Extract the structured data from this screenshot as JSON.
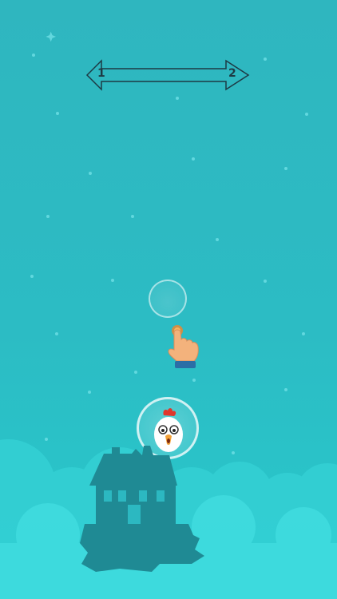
{
  "level": {
    "current": "1",
    "next": "2"
  },
  "hint": {
    "icon": "tap-hand-icon"
  },
  "player": {
    "icon": "chicken-icon"
  },
  "colors": {
    "background": "#2fb6bf",
    "cloud": "#3ad6d6",
    "house": "#1f8a94",
    "bubble": "#ffffff",
    "hand": "#f3b27c",
    "cuff": "#2b6ea6"
  }
}
